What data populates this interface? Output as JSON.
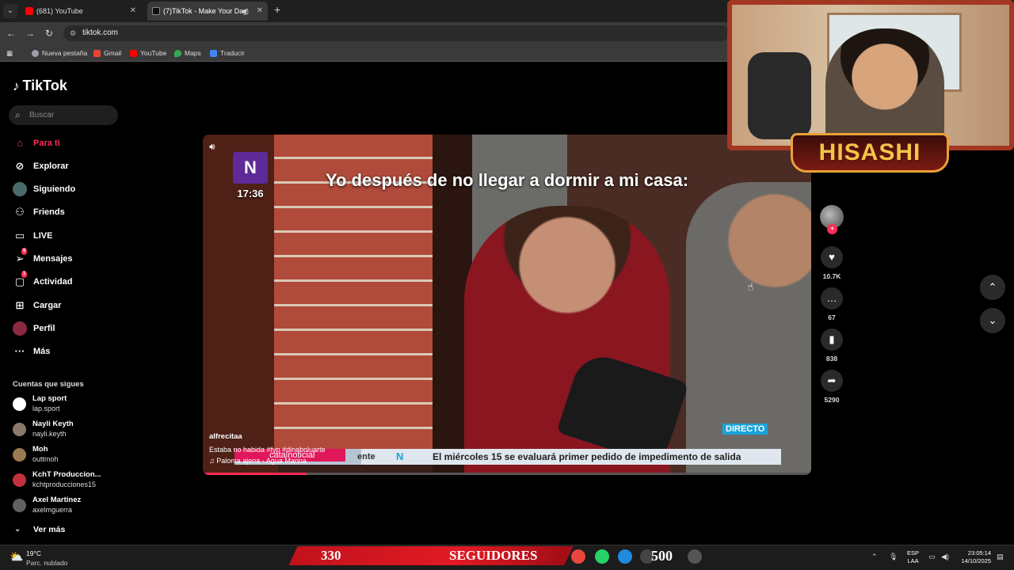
{
  "browser": {
    "tabs": [
      {
        "title": "(681) YouTube",
        "icon_color": "#ff0000"
      },
      {
        "title": "(7)TikTok - Make Your Day",
        "icon_color": "#000000"
      }
    ],
    "url": "tiktok.com",
    "bookmarks": [
      {
        "label": "Nueva pestaña",
        "icon_color": "#9aa0a6"
      },
      {
        "label": "Gmail",
        "icon_color": "#ea4335"
      },
      {
        "label": "YouTube",
        "icon_color": "#ff0000"
      },
      {
        "label": "Maps",
        "icon_color": "#34a853"
      },
      {
        "label": "Traducir",
        "icon_color": "#4285f4"
      }
    ]
  },
  "sidebar": {
    "logo": "TikTok",
    "search_placeholder": "Buscar",
    "nav": [
      {
        "label": "Para ti",
        "icon": "home-icon"
      },
      {
        "label": "Explorar",
        "icon": "compass-icon"
      },
      {
        "label": "Siguiendo",
        "icon": "following-icon"
      },
      {
        "label": "Friends",
        "icon": "friends-icon"
      },
      {
        "label": "LIVE",
        "icon": "live-icon"
      },
      {
        "label": "Mensajes",
        "icon": "messages-icon",
        "badge": "6"
      },
      {
        "label": "Actividad",
        "icon": "activity-icon",
        "badge": "1"
      },
      {
        "label": "Cargar",
        "icon": "upload-icon"
      },
      {
        "label": "Perfil",
        "icon": "profile-icon"
      },
      {
        "label": "Más",
        "icon": "more-icon"
      }
    ],
    "following_title": "Cuentas que sigues",
    "accounts": [
      {
        "name": "Lap sport",
        "handle": "lap.sport",
        "color": "#ffffff"
      },
      {
        "name": "Nayli Keyth",
        "handle": "nayli.keyth",
        "color": "#8a7a6a"
      },
      {
        "name": "Moh",
        "handle": "outtmoh",
        "color": "#9a7a50"
      },
      {
        "name": "KchT Produccion...",
        "handle": "kchtproducciones15",
        "color": "#c03040"
      },
      {
        "name": "Axel Martinez",
        "handle": "axelmguerra",
        "color": "#606060"
      }
    ],
    "see_more": "Ver más"
  },
  "video": {
    "overlay_text": "Yo después de no llegar a dormir a mi casa:",
    "channel_time": "17:36",
    "live_badge": "DIRECTO",
    "ticker_left": "ente",
    "ticker_text": "El miércoles 15 se evaluará primer pedido de impedimento de salida",
    "handle_tag": "catalnoticial",
    "author": "alfrecitaa",
    "caption": "Estaba no habida #fyp  #dinaboluarte",
    "music": "Paloma ajena - Agua Marina",
    "progress": 0.17
  },
  "actions": {
    "likes": "10.7K",
    "comments": "67",
    "saves": "838",
    "shares": "5290"
  },
  "webcam": {
    "name": "HISASHI"
  },
  "taskbar": {
    "temp": "19°C",
    "weather": "Parc. nublado",
    "followers_count": "330",
    "followers_label": "SEGUIDORES",
    "goal": "500",
    "lang_1": "ESP",
    "lang_2": "LAA",
    "time": "23:05:14",
    "date": "14/10/2025"
  }
}
